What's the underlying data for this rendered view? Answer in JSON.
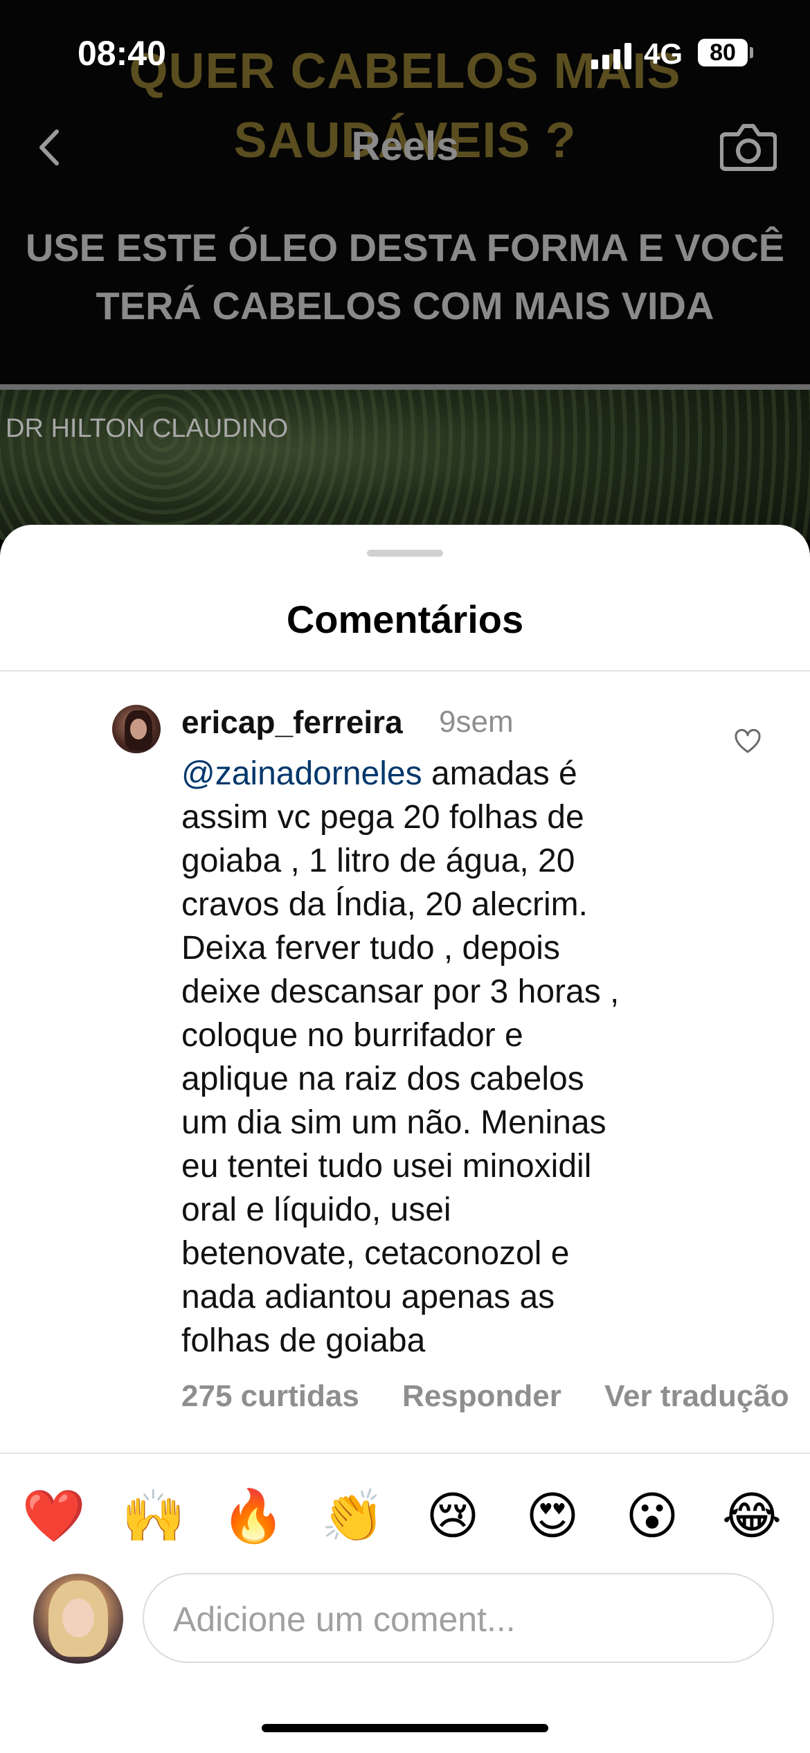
{
  "status_bar": {
    "time": "08:40",
    "network": "4G",
    "battery": "80"
  },
  "background": {
    "headline_line1": "QUER CABELOS MAIS",
    "headline_line2": "SAUDÁVEIS ?",
    "subline_1": "USE ESTE ÓLEO DESTA FORMA E VOCÊ",
    "subline_2": "TERÁ CABELOS COM MAIS VIDA",
    "watermark": "DR HILTON CLAUDINO"
  },
  "nav": {
    "title": "Reels",
    "back_icon": "chevron-left-icon",
    "camera_icon": "camera-icon"
  },
  "sheet": {
    "title": "Comentários"
  },
  "comment": {
    "username": "ericap_ferreira",
    "time": "9sem",
    "mention": "@zainadorneles",
    "text": " amadas é\nassim vc pega 20 folhas de\ngoiaba , 1 litro de água, 20\ncravos da Índia, 20 alecrim.\nDeixa ferver tudo , depois\ndeixe descansar por 3 horas ,\ncoloque no burrifador e\naplique na raiz dos cabelos\num dia sim um não.  Meninas\neu tentei tudo  usei minoxidil\noral e líquido, usei\nbetenovate, cetaconozol  e\nnada adiantou apenas as\nfolhas de goiaba",
    "likes": "275 curtidas",
    "reply_label": "Responder",
    "translate_label": "Ver tradução"
  },
  "reactions": [
    "❤️",
    "🙌",
    "🔥",
    "👏",
    "😢",
    "😍",
    "😮",
    "😂"
  ],
  "composer": {
    "placeholder": "Adicione um coment..."
  }
}
